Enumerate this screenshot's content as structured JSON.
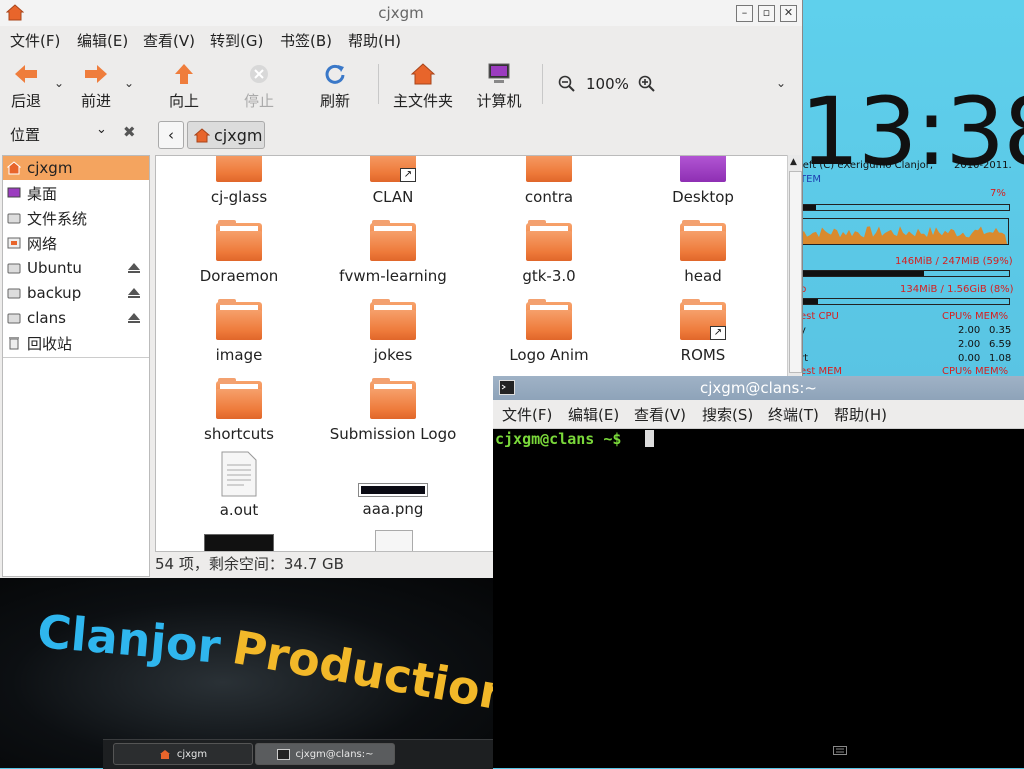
{
  "file_manager": {
    "title": "cjxgm",
    "menu": [
      "文件(F)",
      "编辑(E)",
      "查看(V)",
      "转到(G)",
      "书签(B)",
      "帮助(H)"
    ],
    "toolbar": {
      "back": "后退",
      "forward": "前进",
      "up": "向上",
      "stop": "停止",
      "refresh": "刷新",
      "home": "主文件夹",
      "computer": "计算机",
      "zoom": "100%"
    },
    "sidebar_label": "位置",
    "path_button": "cjxgm",
    "places": [
      {
        "label": "cjxgm",
        "icon": "home-folder-icon",
        "selected": true
      },
      {
        "label": "桌面",
        "icon": "desktop-icon"
      },
      {
        "label": "文件系统",
        "icon": "drive-icon"
      },
      {
        "label": "网络",
        "icon": "network-icon"
      },
      {
        "label": "Ubuntu",
        "icon": "drive-icon",
        "eject": true
      },
      {
        "label": "backup",
        "icon": "drive-icon",
        "eject": true
      },
      {
        "label": "clans",
        "icon": "drive-icon",
        "eject": true
      },
      {
        "label": "回收站",
        "icon": "trash-icon"
      }
    ],
    "files": [
      {
        "name": "cj-glass",
        "icon": "folder-icon"
      },
      {
        "name": "CLAN",
        "icon": "folder-link-icon"
      },
      {
        "name": "contra",
        "icon": "folder-icon"
      },
      {
        "name": "Desktop",
        "icon": "desktop-folder-icon"
      },
      {
        "name": "Doraemon",
        "icon": "folder-icon"
      },
      {
        "name": "fvwm-learning",
        "icon": "folder-icon"
      },
      {
        "name": "gtk-3.0",
        "icon": "folder-icon"
      },
      {
        "name": "head",
        "icon": "folder-icon"
      },
      {
        "name": "image",
        "icon": "folder-icon"
      },
      {
        "name": "jokes",
        "icon": "folder-icon"
      },
      {
        "name": "Logo Anim",
        "icon": "folder-icon"
      },
      {
        "name": "ROMS",
        "icon": "folder-link-icon"
      },
      {
        "name": "shortcuts",
        "icon": "folder-icon"
      },
      {
        "name": "Submission Logo",
        "icon": "folder-icon"
      },
      {
        "name": "a.out",
        "icon": "text-file-icon"
      },
      {
        "name": "aaa.png",
        "icon": "image-file-icon"
      }
    ],
    "status": "54 项，剩余空间：34.7 GB"
  },
  "terminal": {
    "title": "cjxgm@clans:~",
    "menu": [
      "文件(F)",
      "编辑(E)",
      "查看(V)",
      "搜索(S)",
      "终端(T)",
      "帮助(H)"
    ],
    "prompt": "cjxgm@clans ~$"
  },
  "conky": {
    "clock": "13:38",
    "copyleft": "left (C) eXerigumo Clanjor,",
    "years": "2010-2011.",
    "system_label": "TEM",
    "cpu_percent_text": "7%",
    "cpu_fraction": 0.07,
    "mem_text": "146MiB / 247MiB (59%)",
    "mem_fraction": 0.59,
    "swap_label": "p",
    "swap_text": "134MiB / 1.56GiB (8%)",
    "swap_fraction": 0.08,
    "top_cpu_header": "est CPU",
    "cpu_mem_header": "CPU% MEM%",
    "rows": [
      {
        "name": "y",
        "cpu": "2.00",
        "mem": "0.35"
      },
      {
        "name": "",
        "cpu": "2.00",
        "mem": "6.59"
      },
      {
        "name": "rt",
        "cpu": "0.00",
        "mem": "1.08"
      }
    ],
    "top_mem_header": "est MEM",
    "cpu_mem_header2": "CPU% MEM%"
  },
  "wallpaper": {
    "word1": "Clanjor",
    "word2": "Production"
  },
  "taskbar": {
    "items": [
      "cjxgm",
      "cjxgm@clans:~"
    ]
  }
}
